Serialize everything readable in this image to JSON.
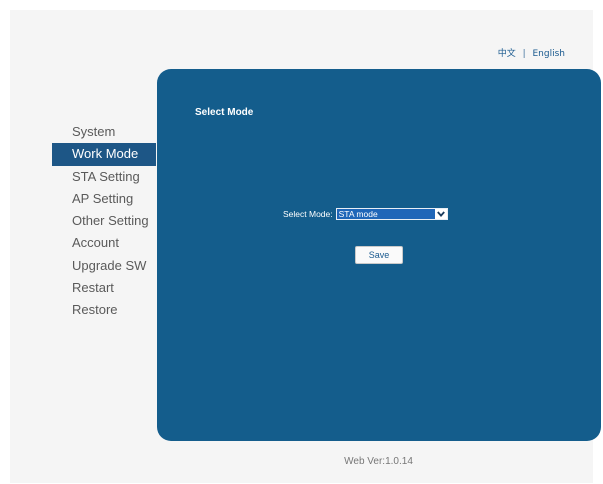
{
  "language": {
    "chinese": "中文",
    "separator": "|",
    "english": "English"
  },
  "sidebar": {
    "items": [
      {
        "label": "System"
      },
      {
        "label": "Work Mode"
      },
      {
        "label": "STA Setting"
      },
      {
        "label": "AP Setting"
      },
      {
        "label": "Other Setting"
      },
      {
        "label": "Account"
      },
      {
        "label": "Upgrade SW"
      },
      {
        "label": "Restart"
      },
      {
        "label": "Restore"
      }
    ],
    "active_index": 1
  },
  "panel": {
    "title": "Select Mode",
    "mode_label": "Select Mode:",
    "mode_value": "STA mode",
    "save_label": "Save"
  },
  "footer": {
    "version": "Web Ver:1.0.14"
  },
  "colors": {
    "panel": "#145d8c",
    "active_nav": "#1d5686",
    "select_bg": "#1f66b8"
  }
}
